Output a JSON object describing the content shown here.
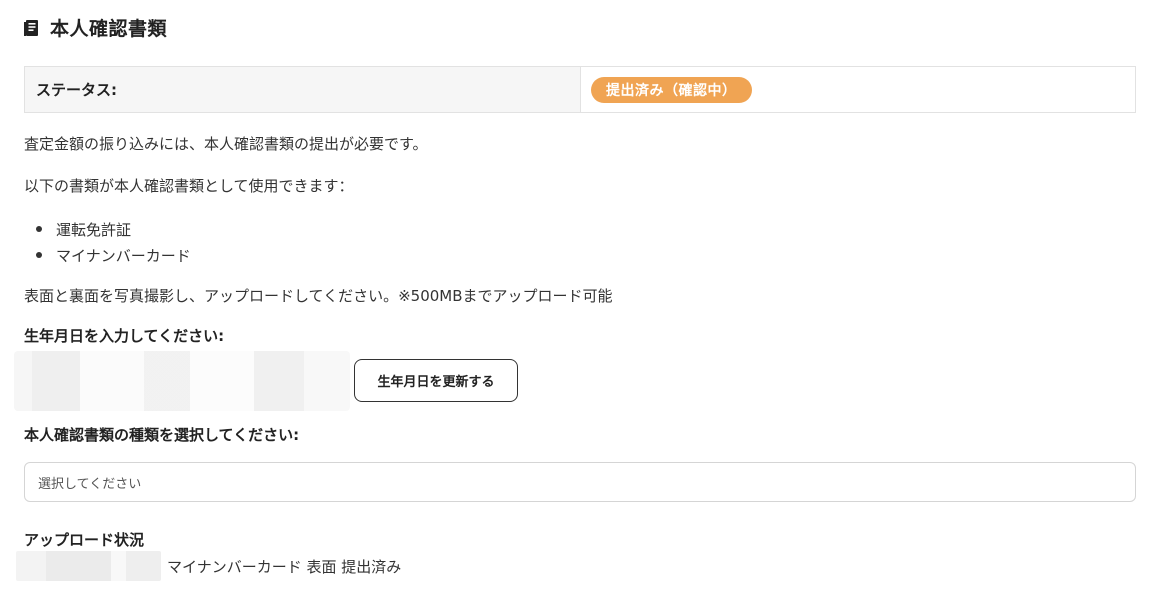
{
  "section": {
    "title": "本人確認書類",
    "icon": "document-icon"
  },
  "status": {
    "label": "ステータス:",
    "badge_text": "提出済み（確認中）",
    "badge_color": "#f0a453"
  },
  "content": {
    "intro": "査定金額の振り込みには、本人確認書類の提出が必要です。",
    "usable_docs_heading": "以下の書類が本人確認書類として使用できます：",
    "usable_docs": [
      "運転免許証",
      "マイナンバーカード"
    ],
    "photo_instruction": "表面と裏面を写真撮影し、アップロードしてください。※500MBまでアップロード可能"
  },
  "birthdate": {
    "label": "生年月日を入力してください:",
    "update_button": "生年月日を更新する"
  },
  "doc_type": {
    "label": "本人確認書類の種類を選択してください:",
    "selected_value": "選択してください"
  },
  "upload_status": {
    "label": "アップロード状況",
    "items": [
      "マイナンバーカード 表面 提出済み"
    ]
  }
}
